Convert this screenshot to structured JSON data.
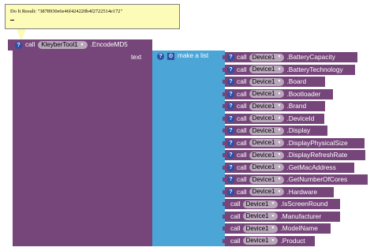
{
  "result": {
    "text": "Do It Result: \"3878930e6e46f424220b4f2722514e172\""
  },
  "outer_call": {
    "call_label": "call",
    "component": "KleyberTool1",
    "method": ".EncodeMD5",
    "param_label": "text"
  },
  "make_list": {
    "label": "make a list"
  },
  "device_calls": [
    {
      "call_label": "call",
      "component": "Device1",
      "method": ".BatteryCapacity",
      "has_help": true
    },
    {
      "call_label": "call",
      "component": "Device1",
      "method": ".BatteryTechnology",
      "has_help": true
    },
    {
      "call_label": "call",
      "component": "Device1",
      "method": ".Board",
      "has_help": true
    },
    {
      "call_label": "call",
      "component": "Device1",
      "method": ".Bootloader",
      "has_help": true
    },
    {
      "call_label": "call",
      "component": "Device1",
      "method": ".Brand",
      "has_help": true
    },
    {
      "call_label": "call",
      "component": "Device1",
      "method": ".DeviceId",
      "has_help": true
    },
    {
      "call_label": "call",
      "component": "Device1",
      "method": ".Display",
      "has_help": true
    },
    {
      "call_label": "call",
      "component": "Device1",
      "method": ".DisplayPhysicalSize",
      "has_help": true
    },
    {
      "call_label": "call",
      "component": "Device1",
      "method": ".DisplayRefreshRate",
      "has_help": true
    },
    {
      "call_label": "call",
      "component": "Device1",
      "method": ".GetMacAddress",
      "has_help": true
    },
    {
      "call_label": "call",
      "component": "Device1",
      "method": ".GetNumberOfCores",
      "has_help": true
    },
    {
      "call_label": "call",
      "component": "Device1",
      "method": ".Hardware",
      "has_help": true
    },
    {
      "call_label": "call",
      "component": "Device1",
      "method": ".IsScreenRound",
      "has_help": false
    },
    {
      "call_label": "call",
      "component": "Device1",
      "method": ".Manufacturer",
      "has_help": false
    },
    {
      "call_label": "call",
      "component": "Device1",
      "method": ".ModelName",
      "has_help": false
    },
    {
      "call_label": "call",
      "component": "Device1",
      "method": ".Product",
      "has_help": false
    }
  ],
  "colors": {
    "procedure_block": "#76457a",
    "list_block": "#4ba5d6",
    "help_icon": "#2d4fa5",
    "bubble": "#fdfbb8"
  }
}
